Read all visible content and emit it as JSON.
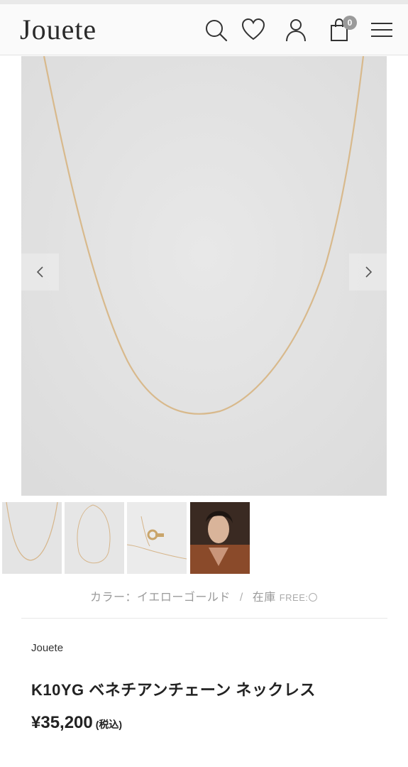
{
  "header": {
    "logo": "Jouete",
    "cart_count": "0",
    "icons": [
      "search-icon",
      "heart-icon",
      "user-icon",
      "bag-icon",
      "menu-icon"
    ]
  },
  "gallery": {
    "prev_icon": "chevron-left-icon",
    "next_icon": "chevron-right-icon",
    "thumbnails": [
      "necklace-flat",
      "necklace-full",
      "clasp-detail",
      "model-wearing"
    ]
  },
  "variant": {
    "color_label": "カラー：イエローゴールド",
    "separator": "/",
    "stock_label": "在庫",
    "size_label": "FREE:〇"
  },
  "product": {
    "brand": "Jouete",
    "name": "K10YG ベネチアンチェーン ネックレス",
    "price": "¥35,200",
    "tax_note": "(税込)"
  },
  "colors": {
    "image_bg": "#e3e3e3",
    "chain": "#d8b98c",
    "badge": "#9a9a9a"
  }
}
